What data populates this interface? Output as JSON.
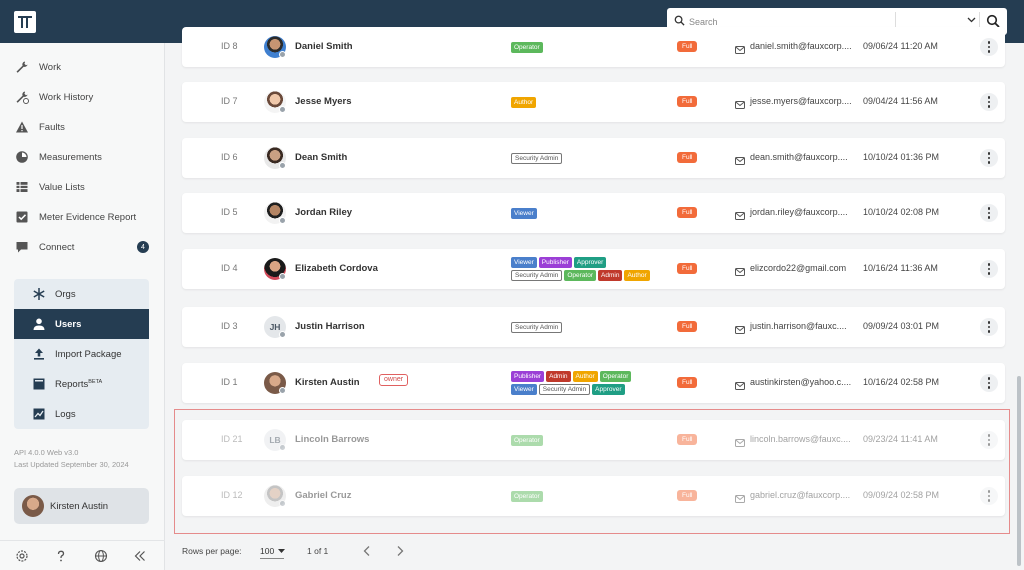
{
  "search": {
    "placeholder": "Search"
  },
  "sidebar": {
    "nav": [
      {
        "label": "Work",
        "icon": "wrench-icon"
      },
      {
        "label": "Work History",
        "icon": "wrench-history-icon"
      },
      {
        "label": "Faults",
        "icon": "warning-icon"
      },
      {
        "label": "Measurements",
        "icon": "gauge-icon"
      },
      {
        "label": "Value Lists",
        "icon": "list-icon"
      },
      {
        "label": "Meter Evidence Report",
        "icon": "checkbox-icon"
      },
      {
        "label": "Connect",
        "icon": "chat-icon",
        "badge": "4"
      }
    ],
    "admin": [
      {
        "label": "Orgs",
        "icon": "snowflake-icon"
      },
      {
        "label": "Users",
        "icon": "person-icon",
        "active": true
      },
      {
        "label": "Import Package",
        "icon": "upload-icon"
      },
      {
        "label": "Reports",
        "sup": "BETA",
        "icon": "report-icon"
      },
      {
        "label": "Logs",
        "icon": "chart-line-icon"
      }
    ],
    "version_line1": "API 4.0.0 Web v3.0",
    "version_line2": "Last Updated September 30, 2024",
    "user_name": "Kirsten Austin"
  },
  "rows": [
    {
      "id": "ID 8",
      "name": "Daniel Smith",
      "roles": [
        [
          "Operator"
        ]
      ],
      "access": "Full",
      "email": "daniel.smith@fauxcorp....",
      "date": "09/06/24 11:20 AM"
    },
    {
      "id": "ID 7",
      "name": "Jesse Myers",
      "roles": [
        [
          "Author"
        ]
      ],
      "access": "Full",
      "email": "jesse.myers@fauxcorp....",
      "date": "09/04/24 11:56 AM"
    },
    {
      "id": "ID 6",
      "name": "Dean Smith",
      "roles": [
        [
          "Security Admin"
        ]
      ],
      "access": "Full",
      "email": "dean.smith@fauxcorp....",
      "date": "10/10/24 01:36 PM"
    },
    {
      "id": "ID 5",
      "name": "Jordan Riley",
      "roles": [
        [
          "Viewer"
        ]
      ],
      "access": "Full",
      "email": "jordan.riley@fauxcorp....",
      "date": "10/10/24 02:08 PM"
    },
    {
      "id": "ID 4",
      "name": "Elizabeth Cordova",
      "roles": [
        [
          "Viewer",
          "Publisher",
          "Approver"
        ],
        [
          "Security Admin",
          "Operator",
          "Admin",
          "Author"
        ]
      ],
      "access": "Full",
      "email": "elizcordo22@gmail.com",
      "date": "10/16/24 11:36 AM"
    },
    {
      "id": "ID 3",
      "name": "Justin Harrison",
      "initials": "JH",
      "roles": [
        [
          "Security Admin"
        ]
      ],
      "access": "Full",
      "email": "justin.harrison@fauxc....",
      "date": "09/09/24 03:01 PM"
    },
    {
      "id": "ID 1",
      "name": "Kirsten Austin",
      "owner": "owner",
      "roles": [
        [
          "Publisher",
          "Admin",
          "Author",
          "Operator"
        ],
        [
          "Viewer",
          "Security Admin",
          "Approver"
        ]
      ],
      "access": "Full",
      "email": "austinkirsten@yahoo.c....",
      "date": "10/16/24 02:58 PM"
    },
    {
      "id": "ID 21",
      "name": "Lincoln Barrows",
      "initials": "LB",
      "faded": true,
      "roles": [
        [
          "Operator"
        ]
      ],
      "access": "Full",
      "email": "lincoln.barrows@fauxc....",
      "date": "09/23/24 11:41 AM"
    },
    {
      "id": "ID 12",
      "name": "Gabriel Cruz",
      "faded": true,
      "roles": [
        [
          "Operator"
        ]
      ],
      "access": "Full",
      "email": "gabriel.cruz@fauxcorp....",
      "date": "09/09/24 02:58 PM"
    }
  ],
  "pager": {
    "rows_per_page_label": "Rows per page:",
    "rows_per_page": "100",
    "page_info": "1 of 1"
  },
  "colors": {
    "topbar": "#253d52",
    "full_badge": "#f26b3a",
    "selection_border": "#e58b8b"
  }
}
